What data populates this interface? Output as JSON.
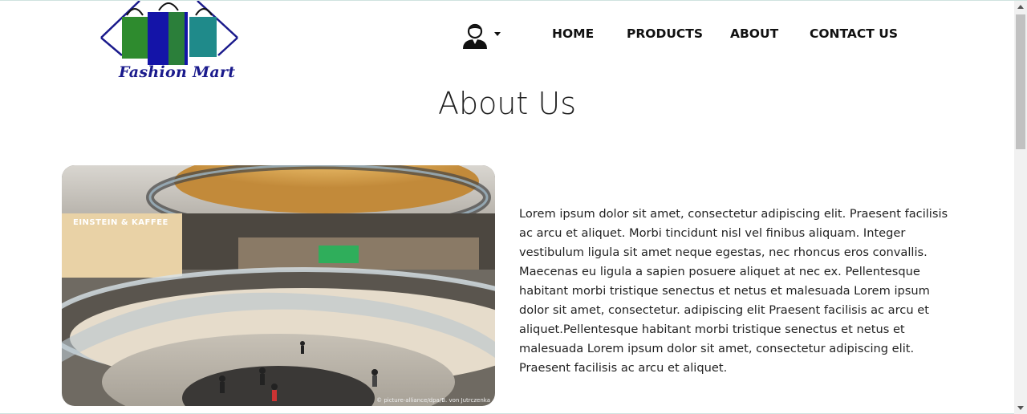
{
  "header": {
    "logo_text": "Fashion Mart",
    "nav": {
      "home": "HOME",
      "products": "PRODUCTS",
      "about": "ABOUT",
      "contact": "CONTACT US"
    }
  },
  "main": {
    "title": "About Us",
    "photo": {
      "store_sign": "EINSTEIN & KAFFEE",
      "credit": "© picture-alliance/dpa/B. von Jutrczenka"
    },
    "paragraph": "Lorem ipsum dolor sit amet, consectetur adipiscing elit. Praesent facilisis ac arcu et aliquet. Morbi tincidunt nisl vel finibus aliquam. Integer vestibulum ligula sit amet neque egestas, nec rhoncus eros convallis. Maecenas eu ligula a sapien posuere aliquet at nec ex. Pellentesque habitant morbi tristique senectus et netus et malesuada Lorem ipsum dolor sit amet, consectetur. adipiscing elit Praesent facilisis ac arcu et aliquet.Pellentesque habitant morbi tristique senectus et netus et malesuada Lorem ipsum dolor sit amet, consectetur adipiscing elit. Praesent facilisis ac arcu et aliquet."
  },
  "icons": {
    "logo": "shopping-bags-logo-icon",
    "user": "user-avatar-icon",
    "caret": "caret-down-icon"
  },
  "colors": {
    "logo_outline": "#1a1a8c",
    "bag_green": "#2e8b2e",
    "bag_blue": "#1414a8",
    "bag_teal": "#1f8a8a"
  }
}
